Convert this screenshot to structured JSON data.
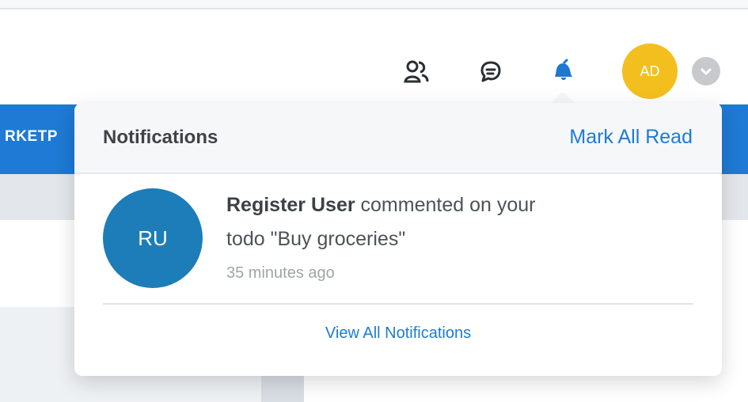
{
  "header": {
    "avatar_initials": "AD",
    "users_icon": "users-icon",
    "chat_icon": "chat-icon",
    "bell_icon": "bell-icon",
    "dropdown_icon": "chevron-down-icon"
  },
  "background": {
    "section_label": "RKETP"
  },
  "notifications": {
    "title": "Notifications",
    "mark_all_read": "Mark All Read",
    "items": [
      {
        "avatar_initials": "RU",
        "user": "Register User",
        "message_part_1": " commented on your",
        "message_part_2": "todo \"Buy groceries\"",
        "time": "35 minutes ago"
      }
    ],
    "view_all": "View All Notifications"
  },
  "colors": {
    "primary_blue": "#1e7ad4",
    "avatar_yellow": "#f3bf1f",
    "notification_avatar_blue": "#1d7db8"
  }
}
